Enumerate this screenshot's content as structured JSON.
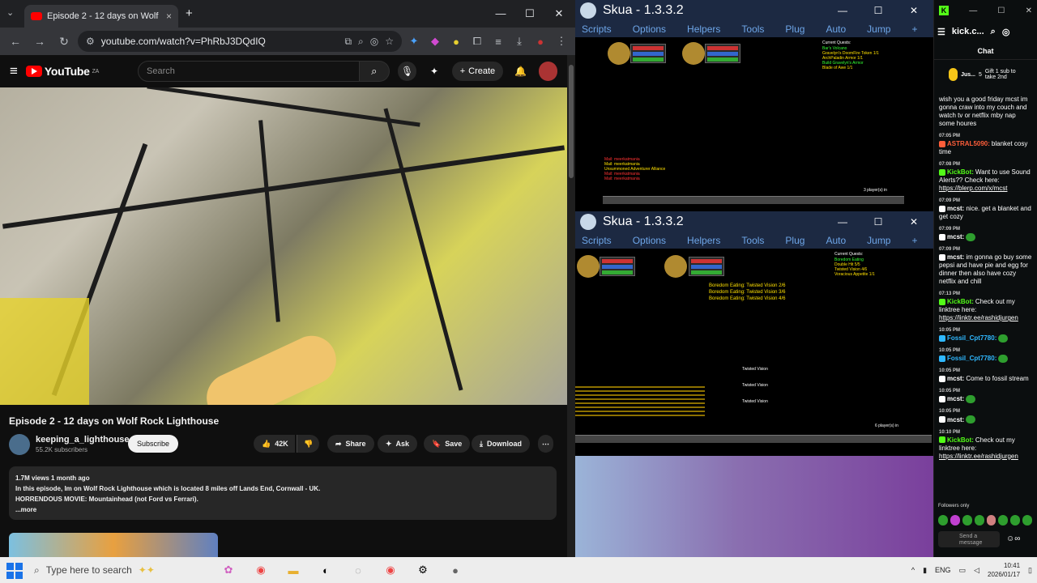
{
  "browser": {
    "tab_title": "Episode 2 - 12 days on Wolf Rock Lighthouse",
    "tab_close": "×",
    "new_tab": "+",
    "url": "youtube.com/watch?v=PhRbJ3DQdIQ",
    "win_min": "—",
    "win_max": "☐",
    "win_close": "✕"
  },
  "youtube": {
    "logo_text": "YouTube",
    "logo_sup": "ZA",
    "search_placeholder": "Search",
    "create_label": "Create",
    "video_title": "Episode 2 - 12 days on Wolf Rock Lighthouse",
    "channel_name": "keeping_a_lighthouse",
    "subscribers": "55.2K subscribers",
    "subscribe_label": "Subscribe",
    "likes": "42K",
    "share_label": "Share",
    "ask_label": "Ask",
    "save_label": "Save",
    "download_label": "Download",
    "more_label": "⋯",
    "desc_stats": "1.7M views  1 month ago",
    "desc_line1": "In this episode, Im on Wolf Rock Lighthouse which is located 8 miles off Lands End, Cornwall - UK.",
    "desc_line2": "HORRENDOUS MOVIE: Mountainhead (not Ford vs Ferrari).",
    "desc_more": "...more"
  },
  "skua_top": {
    "title": "Skua - 1.3.3.2",
    "menu": [
      "Scripts",
      "Options",
      "Helpers",
      "Tools",
      "Plug",
      "Auto",
      "Jump",
      "+"
    ],
    "quests_title": "Current Quests:",
    "quest_lines": [
      "Bar's Volcano",
      "Gravelyn's DoomFire Token 1/1",
      "ArchPaladin Armor 1/1",
      "Build Gravelyn's Armor",
      "Blade of Awe 1/1"
    ],
    "log_lines": [
      "Mail: meerkatmania",
      "Mail: meerkatmania",
      "Unsummoned Adventurer Alliance",
      "Mail: meerkatmania",
      "Mail: meerkatmania"
    ],
    "players": "3 player(s) in"
  },
  "skua_bottom": {
    "title": "Skua - 1.3.3.2",
    "menu": [
      "Scripts",
      "Options",
      "Helpers",
      "Tools",
      "Plug",
      "Auto",
      "Jump",
      "+"
    ],
    "quests_title": "Current Quests:",
    "quest_lines": [
      "Boredom Eating",
      "Double Hit 5/5",
      "Twisted Vision 4/6",
      "Voracious Appetite 1/1"
    ],
    "boredom_lines": [
      "Boredom Eating: Twisted Vision 2/6",
      "Boredom Eating: Twisted Vision 3/6",
      "Boredom Eating: Twisted Vision 4/6"
    ],
    "item_lines": [
      "Twisted Vision",
      "Twisted Vision",
      "Twisted Vision"
    ],
    "players": "6 player(s) in"
  },
  "chat": {
    "channel": "kick.c...",
    "header": "Chat",
    "gift_user": "Jus...",
    "gift_count": "5",
    "gift_text": "Gift 1 sub to take 2nd",
    "messages": [
      {
        "time": "",
        "user": "",
        "color": "#ff5e3a",
        "text": "wish you a good friday mcst im gonna craw into my couch and watch tv or netflix mby nap some houres"
      },
      {
        "time": "07:05 PM",
        "user": "ASTRAL5090:",
        "color": "#ff5e3a",
        "text": "blanket cosy time"
      },
      {
        "time": "07:08 PM",
        "user": "KickBot:",
        "color": "#53fc18",
        "text": "Want to use Sound Alerts?? Check here:",
        "link": "https://blerp.com/x/mcst"
      },
      {
        "time": "07:09 PM",
        "user": "mcst:",
        "color": "#ffffff",
        "text": "nice. get a blanket and get cozy"
      },
      {
        "time": "07:09 PM",
        "user": "mcst:",
        "color": "#ffffff",
        "text": ""
      },
      {
        "time": "07:09 PM",
        "user": "mcst:",
        "color": "#ffffff",
        "text": "im gonna go buy some pepsi and have pie and egg for dinner then also have cozy netflix and chill"
      },
      {
        "time": "07:13 PM",
        "user": "KickBot:",
        "color": "#53fc18",
        "text": "Check out my linktree here:",
        "link": "https://linktr.ee/rashidjurgen"
      },
      {
        "time": "10:05 PM",
        "user": "Fossil_Cpt7780:",
        "color": "#2fb8ff",
        "text": ""
      },
      {
        "time": "10:05 PM",
        "user": "Fossil_Cpt7780:",
        "color": "#2fb8ff",
        "text": ""
      },
      {
        "time": "10:05 PM",
        "user": "mcst:",
        "color": "#ffffff",
        "text": "Come to fossil stream"
      },
      {
        "time": "10:05 PM",
        "user": "mcst:",
        "color": "#ffffff",
        "text": ""
      },
      {
        "time": "10:05 PM",
        "user": "mcst:",
        "color": "#ffffff",
        "text": ""
      },
      {
        "time": "10:10 PM",
        "user": "KickBot:",
        "color": "#53fc18",
        "text": "Check out my linktree here:",
        "link": "https://linktr.ee/rashidjurgen"
      }
    ],
    "followers_only": "Followers only",
    "send_placeholder": "Send a message"
  },
  "taskbar": {
    "search_placeholder": "Type here to search",
    "lang": "ENG",
    "time": "10:41",
    "date": "2026/01/17"
  },
  "colors": {
    "youtube_red": "#ff0000",
    "kick_green": "#53fc18",
    "skua_bar": "#1c2942"
  }
}
